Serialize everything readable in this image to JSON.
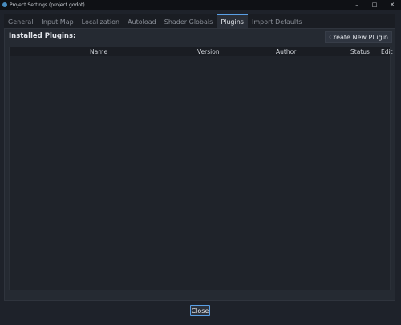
{
  "window": {
    "title": "Project Settings (project.godot)",
    "minimize_glyph": "–",
    "maximize_glyph": "□",
    "close_glyph": "✕"
  },
  "tabs": [
    {
      "label": "General"
    },
    {
      "label": "Input Map"
    },
    {
      "label": "Localization"
    },
    {
      "label": "Autoload"
    },
    {
      "label": "Shader Globals"
    },
    {
      "label": "Plugins",
      "active": true
    },
    {
      "label": "Import Defaults"
    }
  ],
  "plugins": {
    "section_label": "Installed Plugins:",
    "create_button": "Create New Plugin",
    "columns": [
      "Name",
      "Version",
      "Author",
      "Status",
      "Edit"
    ],
    "rows": []
  },
  "footer": {
    "close_button": "Close"
  },
  "colors": {
    "accent": "#5aa0e6",
    "background": "#1e222a"
  }
}
